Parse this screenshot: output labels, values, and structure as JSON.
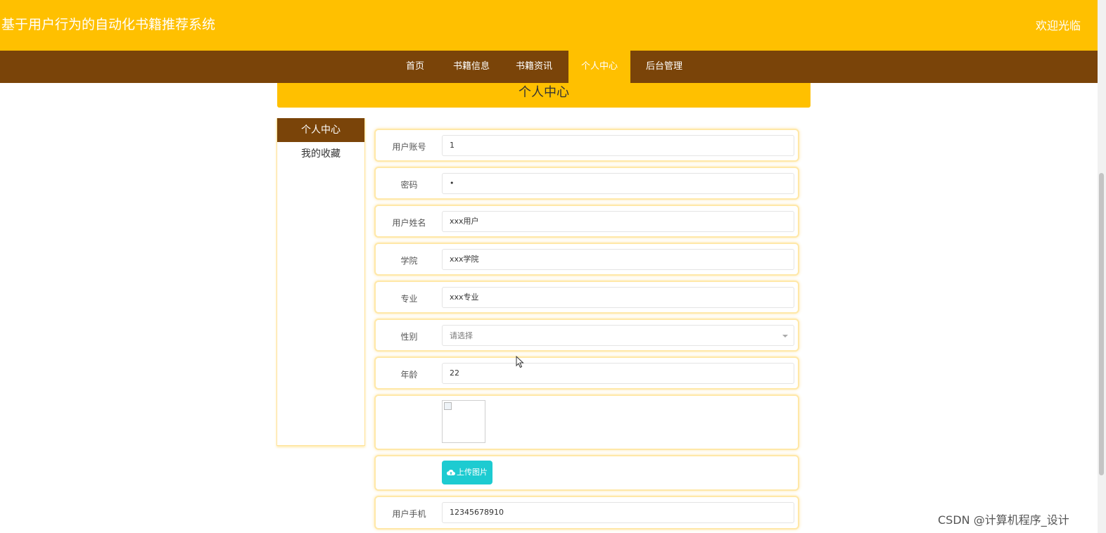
{
  "header": {
    "title": "基于用户行为的自动化书籍推荐系统",
    "welcome": "欢迎光临"
  },
  "nav": {
    "items": [
      "首页",
      "书籍信息",
      "书籍资讯",
      "个人中心",
      "后台管理"
    ],
    "active": "个人中心"
  },
  "page": {
    "banner_title": "个人中心"
  },
  "sidebar": {
    "items": [
      "个人中心",
      "我的收藏"
    ],
    "active": "个人中心"
  },
  "form": {
    "account": {
      "label": "用户账号",
      "value": "1"
    },
    "password": {
      "label": "密码",
      "value": "•"
    },
    "name": {
      "label": "用户姓名",
      "value": "xxx用户"
    },
    "college": {
      "label": "学院",
      "value": "xxx学院"
    },
    "major": {
      "label": "专业",
      "value": "xxx专业"
    },
    "gender": {
      "label": "性别",
      "placeholder": "请选择"
    },
    "age": {
      "label": "年龄",
      "value": "22"
    },
    "upload": {
      "button_label": "上传图片"
    },
    "phone": {
      "label": "用户手机",
      "value": "12345678910"
    }
  },
  "watermark": "CSDN @计算机程序_设计",
  "colors": {
    "header_bg": "#FFC000",
    "nav_bg": "#7A4409",
    "upload_button": "#1DCBD1"
  },
  "icons": {
    "upload": "cloud-upload-icon",
    "select": "chevron-down-icon",
    "image": "broken-image-icon",
    "cursor": "mouse-cursor-icon"
  }
}
